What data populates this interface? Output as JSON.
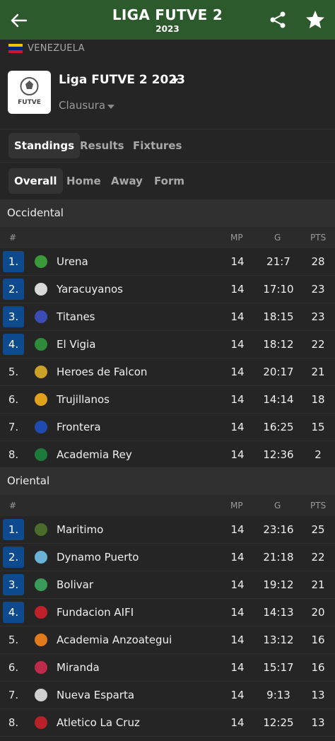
{
  "header": {
    "title": "LIGA FUTVE 2",
    "subtitle": "2023"
  },
  "country": {
    "name": "VENEZUELA",
    "flag_colors": [
      "#f2c300",
      "#00247d",
      "#cf142b"
    ]
  },
  "league": {
    "name": "Liga FUTVE 2 2023",
    "season": "Clausura",
    "logo_text": "FUTVE"
  },
  "tabs": [
    "Standings",
    "Results",
    "Fixtures"
  ],
  "subtabs": [
    "Overall",
    "Home",
    "Away",
    "Form"
  ],
  "columns": {
    "rank": "#",
    "mp": "MP",
    "g": "G",
    "pts": "PTS"
  },
  "groups": [
    {
      "name": "Occidental",
      "rows": [
        {
          "rank": "1.",
          "team": "Urena",
          "mp": "14",
          "g": "21:7",
          "pts": "28",
          "qualified": true,
          "crest": "#3a9a3a"
        },
        {
          "rank": "2.",
          "team": "Yaracuyanos",
          "mp": "14",
          "g": "17:10",
          "pts": "23",
          "qualified": true,
          "crest": "#d9d9d9"
        },
        {
          "rank": "3.",
          "team": "Titanes",
          "mp": "14",
          "g": "18:15",
          "pts": "23",
          "qualified": true,
          "crest": "#3b4db5"
        },
        {
          "rank": "4.",
          "team": "El Vigia",
          "mp": "14",
          "g": "18:12",
          "pts": "22",
          "qualified": true,
          "crest": "#2e8b3a"
        },
        {
          "rank": "5.",
          "team": "Heroes de Falcon",
          "mp": "14",
          "g": "20:17",
          "pts": "21",
          "qualified": false,
          "crest": "#c9a227"
        },
        {
          "rank": "6.",
          "team": "Trujillanos",
          "mp": "14",
          "g": "14:14",
          "pts": "18",
          "qualified": false,
          "crest": "#e0a21a"
        },
        {
          "rank": "7.",
          "team": "Frontera",
          "mp": "14",
          "g": "16:25",
          "pts": "15",
          "qualified": false,
          "crest": "#1f4bb0"
        },
        {
          "rank": "8.",
          "team": "Academia Rey",
          "mp": "14",
          "g": "12:36",
          "pts": "2",
          "qualified": false,
          "crest": "#1e7a3a"
        }
      ]
    },
    {
      "name": "Oriental",
      "rows": [
        {
          "rank": "1.",
          "team": "Maritimo",
          "mp": "14",
          "g": "23:16",
          "pts": "25",
          "qualified": true,
          "crest": "#4a6b2a"
        },
        {
          "rank": "2.",
          "team": "Dynamo Puerto",
          "mp": "14",
          "g": "21:18",
          "pts": "22",
          "qualified": true,
          "crest": "#6bb3d6"
        },
        {
          "rank": "3.",
          "team": "Bolivar",
          "mp": "14",
          "g": "19:12",
          "pts": "21",
          "qualified": true,
          "crest": "#3a9a5a"
        },
        {
          "rank": "4.",
          "team": "Fundacion AIFI",
          "mp": "14",
          "g": "14:13",
          "pts": "20",
          "qualified": true,
          "crest": "#c0202a"
        },
        {
          "rank": "5.",
          "team": "Academia Anzoategui",
          "mp": "14",
          "g": "13:12",
          "pts": "16",
          "qualified": false,
          "crest": "#e07a1a"
        },
        {
          "rank": "6.",
          "team": "Miranda",
          "mp": "14",
          "g": "15:17",
          "pts": "16",
          "qualified": false,
          "crest": "#c02a4a"
        },
        {
          "rank": "7.",
          "team": "Nueva Esparta",
          "mp": "14",
          "g": "9:13",
          "pts": "13",
          "qualified": false,
          "crest": "#d0d0d0"
        },
        {
          "rank": "8.",
          "team": "Atletico La Cruz",
          "mp": "14",
          "g": "12:25",
          "pts": "13",
          "qualified": false,
          "crest": "#b8202a"
        }
      ]
    }
  ]
}
